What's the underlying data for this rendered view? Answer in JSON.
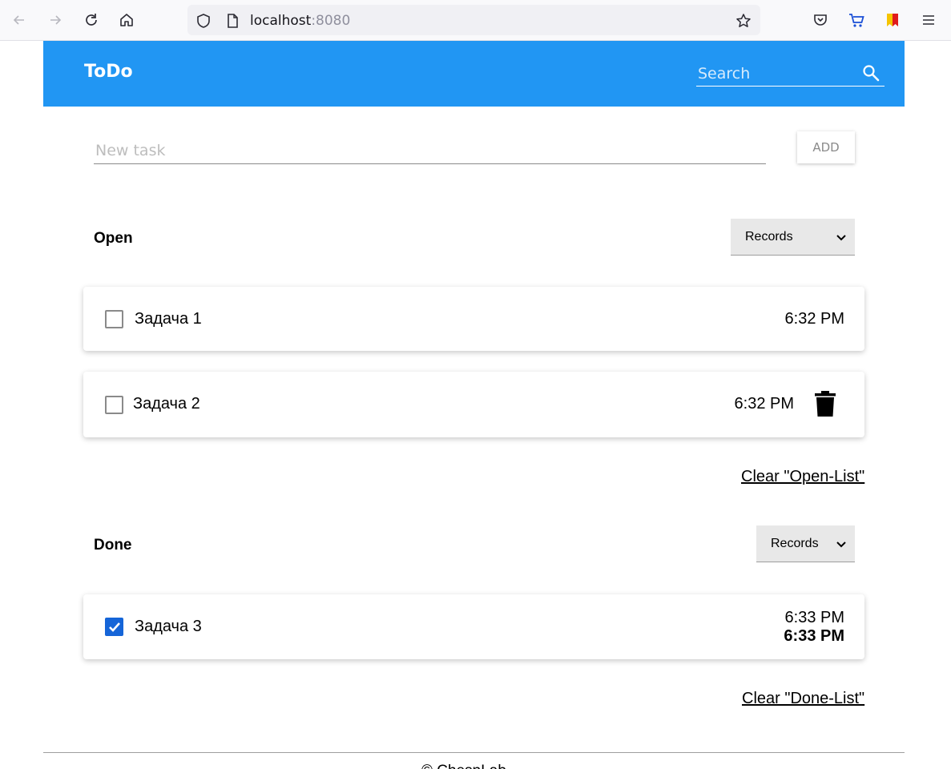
{
  "browser": {
    "url_host": "localhost",
    "url_port": ":8080"
  },
  "header": {
    "title": "ToDo",
    "search_placeholder": "Search"
  },
  "new_task": {
    "placeholder": "New task",
    "add_label": "ADD"
  },
  "open_section": {
    "title": "Open",
    "select_value": "Records",
    "tasks": [
      {
        "name": "Задача 1",
        "time": "6:32 PM",
        "checked": false
      },
      {
        "name": "Задача 2",
        "time": "6:32 PM",
        "checked": false
      }
    ],
    "clear_label": "Clear \"Open-List\""
  },
  "done_section": {
    "title": "Done",
    "select_value": "Records",
    "tasks": [
      {
        "name": "Задача 3",
        "time": "6:33 PM",
        "done_time": "6:33 PM",
        "checked": true
      }
    ],
    "clear_label": "Clear \"Done-List\""
  },
  "footer": {
    "text": "© ChesnLab"
  },
  "colors": {
    "header_bg": "#2196f3",
    "checkbox_checked": "#1565d8"
  }
}
